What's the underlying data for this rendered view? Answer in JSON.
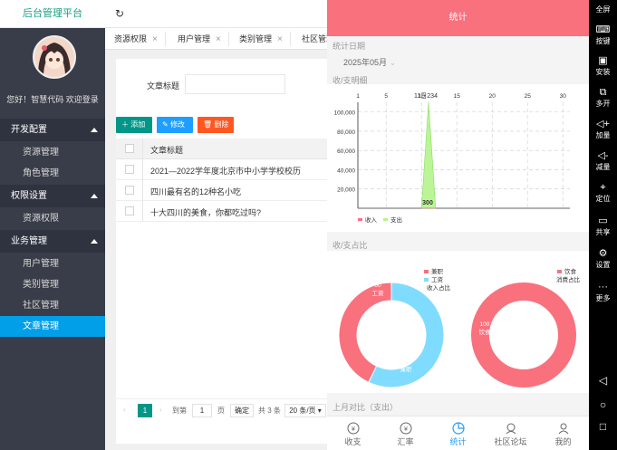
{
  "app": {
    "title": "后台管理平台",
    "welcome": "您好！智慧代码 欢迎登录"
  },
  "sidebar": {
    "groups": [
      {
        "label": "开发配置",
        "items": [
          "资源管理",
          "角色管理"
        ]
      },
      {
        "label": "权限设置",
        "items": [
          "资源权限"
        ]
      },
      {
        "label": "业务管理",
        "items": [
          "用户管理",
          "类别管理",
          "社区管理",
          "文章管理"
        ]
      }
    ],
    "active_item": "文章管理"
  },
  "tabs": [
    "资源权限",
    "用户管理",
    "类别管理",
    "社区管理"
  ],
  "search": {
    "label": "文章标题",
    "value": ""
  },
  "toolbar": {
    "add": "添加",
    "edit": "修改",
    "delete": "删除"
  },
  "table": {
    "header": "文章标题",
    "rows": [
      "2021—2022学年度北京市中小学学校校历",
      "四川最有名的12种名小吃",
      "十大四川的美食，你都吃过吗?"
    ]
  },
  "pager": {
    "current": "1",
    "goto_label": "到第",
    "goto_value": "1",
    "page_unit": "页",
    "confirm": "确定",
    "total": "共 3 条",
    "page_size": "20 条/页"
  },
  "stats": {
    "header": "统计",
    "date_label": "统计日期",
    "month": "2025年05月",
    "bar_title": "收/支明细",
    "pie_title": "收/支占比",
    "compare_title": "上月对比（支出）"
  },
  "chart_data": [
    {
      "type": "area",
      "title": "收/支明细",
      "x_ticks": [
        "1",
        "5",
        "10",
        "15",
        "20",
        "25",
        "30"
      ],
      "y_ticks": [
        "20,000",
        "40,000",
        "60,000",
        "80,000",
        "100,000"
      ],
      "ylim": [
        0,
        110000
      ],
      "xlim": [
        1,
        31
      ],
      "top_label": "11日234",
      "series": [
        {
          "name": "收入",
          "color": "#ff6b81",
          "x": [
            10,
            11,
            12
          ],
          "values": [
            0,
            234,
            0
          ]
        },
        {
          "name": "支出",
          "color": "#b5f58a",
          "x": [
            10,
            11,
            12
          ],
          "values": [
            0,
            110000,
            0
          ]
        }
      ],
      "annotations": [
        {
          "x": 11,
          "label": "300"
        }
      ],
      "legend": "bottom-left"
    },
    {
      "type": "pie",
      "title": "收入占比",
      "legend_entries": [
        "兼职",
        "工资"
      ],
      "slices": [
        {
          "label": "兼职",
          "value": 45,
          "color": "#f8717d"
        },
        {
          "label": "工资",
          "value": 60,
          "color": "#7fdcff"
        }
      ],
      "inner_labels": [
        "60\n工资",
        "45\n兼职"
      ],
      "legend": "top-right"
    },
    {
      "type": "pie",
      "title": "消费占比",
      "legend_entries": [
        "饮食"
      ],
      "slices": [
        {
          "label": "饮食",
          "value": 100,
          "color": "#f8717d"
        }
      ],
      "inner_labels": [
        "100\n饮食"
      ],
      "legend": "top-right"
    }
  ],
  "bottom_tabs": [
    {
      "label": "收支",
      "icon": "wallet-icon"
    },
    {
      "label": "汇率",
      "icon": "exchange-icon"
    },
    {
      "label": "统计",
      "icon": "chart-icon"
    },
    {
      "label": "社区论坛",
      "icon": "forum-icon"
    },
    {
      "label": "我的",
      "icon": "user-icon"
    }
  ],
  "navbar": [
    "全屏",
    "按键",
    "安装",
    "多开",
    "加量",
    "减量",
    "定位",
    "共享",
    "设置",
    "更多"
  ],
  "colors": {
    "accent": "#f8717d",
    "sidebar": "#393d49",
    "active": "#009fe8",
    "primary": "#1e9fff",
    "green": "#009688"
  }
}
